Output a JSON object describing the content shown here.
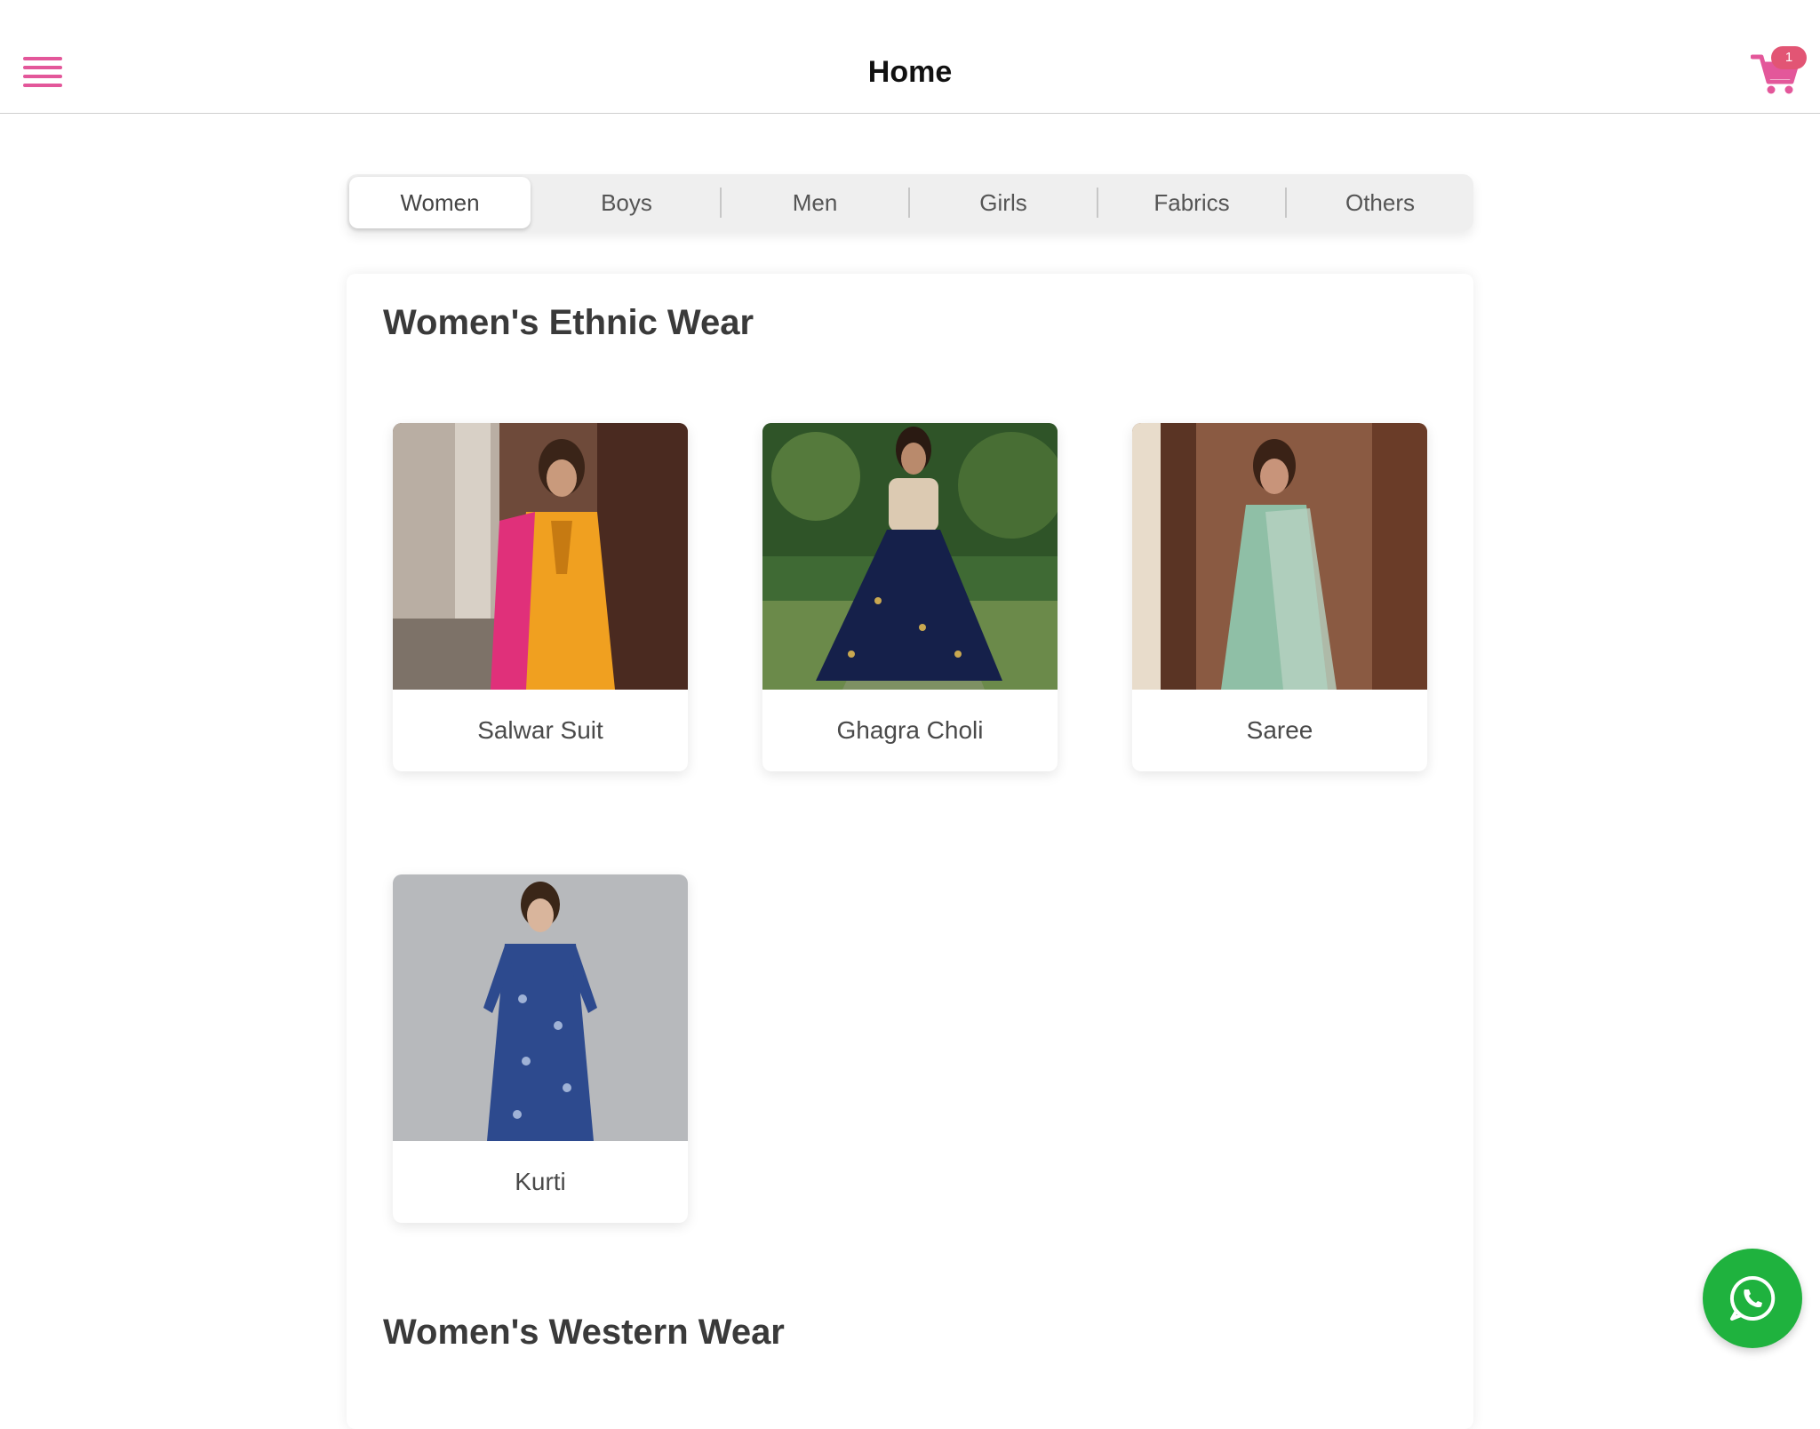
{
  "header": {
    "title": "Home",
    "menu_icon": "hamburger-menu-icon",
    "cart_icon": "shopping-cart-icon",
    "cart_count": "1",
    "accent_color": "#e3579a",
    "badge_color": "#e25574"
  },
  "tabs": [
    {
      "label": "Women",
      "active": true
    },
    {
      "label": "Boys",
      "active": false
    },
    {
      "label": "Men",
      "active": false
    },
    {
      "label": "Girls",
      "active": false
    },
    {
      "label": "Fabrics",
      "active": false
    },
    {
      "label": "Others",
      "active": false
    }
  ],
  "sections": [
    {
      "title": "Women's Ethnic Wear",
      "products": [
        {
          "label": "Salwar Suit"
        },
        {
          "label": "Ghagra Choli"
        },
        {
          "label": "Saree"
        },
        {
          "label": "Kurti"
        }
      ]
    },
    {
      "title": "Women's Western Wear",
      "products": []
    }
  ],
  "fab": {
    "icon": "whatsapp-icon",
    "color": "#1fb23e"
  }
}
